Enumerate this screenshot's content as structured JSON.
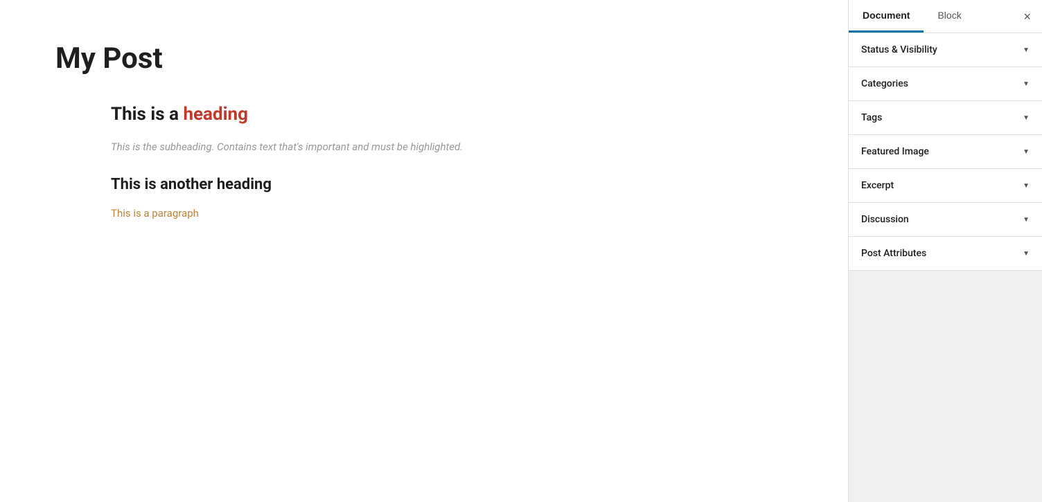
{
  "main": {
    "post_title": "My Post",
    "content": {
      "heading1": "This is a heading",
      "heading1_plain": "This is a ",
      "heading1_highlight": "heading",
      "subheading": "This is the subheading. Contains text that's important and must be highlighted.",
      "heading2": "This is another heading",
      "paragraph": "This is a paragraph"
    }
  },
  "sidebar": {
    "tabs": [
      {
        "id": "document",
        "label": "Document",
        "active": true
      },
      {
        "id": "block",
        "label": "Block",
        "active": false
      }
    ],
    "close_label": "×",
    "panels": [
      {
        "id": "status-visibility",
        "label": "Status & Visibility"
      },
      {
        "id": "categories",
        "label": "Categories"
      },
      {
        "id": "tags",
        "label": "Tags"
      },
      {
        "id": "featured-image",
        "label": "Featured Image"
      },
      {
        "id": "excerpt",
        "label": "Excerpt"
      },
      {
        "id": "discussion",
        "label": "Discussion"
      },
      {
        "id": "post-attributes",
        "label": "Post Attributes"
      }
    ]
  }
}
